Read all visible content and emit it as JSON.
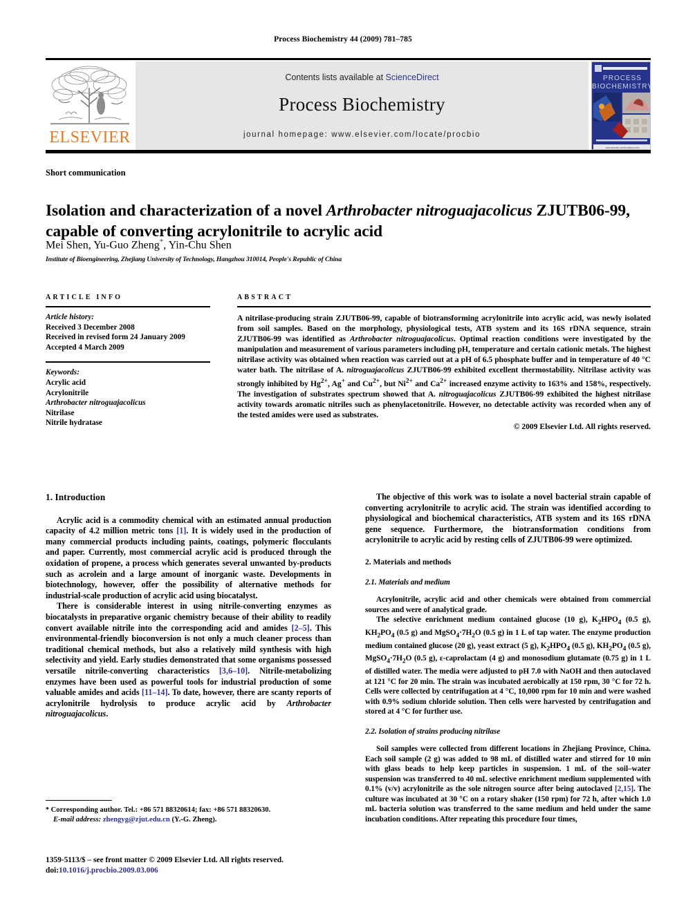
{
  "running_head": "Process Biochemistry 44 (2009) 781–785",
  "masthead": {
    "contents_prefix": "Contents lists available at",
    "sciencedirect": "ScienceDirect",
    "journal_name": "Process Biochemistry",
    "homepage": "journal homepage: www.elsevier.com/locate/procbio",
    "publisher": "ELSEVIER",
    "cover_title_line1": "PROCESS",
    "cover_title_line2": "BIOCHEMISTRY",
    "accent_orange": "#E87722",
    "link_blue": "#2E3192",
    "band_grey": "#e6e6e6"
  },
  "article": {
    "type": "Short communication",
    "title_part1": "Isolation and characterization of a novel ",
    "title_italic": "Arthrobacter nitroguajacolicus",
    "title_part2": " ZJUTB06-99, capable of converting acrylonitrile to acrylic acid",
    "authors": "Mei Shen, Yu-Guo Zheng",
    "author_marker": "*",
    "authors_tail": ", Yin-Chu Shen",
    "affiliation": "Institute of Bioengineering, Zhejiang University of Technology, Hangzhou 310014, People's Republic of China"
  },
  "article_info": {
    "heading": "ARTICLE INFO",
    "history_label": "Article history:",
    "history": [
      "Received 3 December 2008",
      "Received in revised form 24 January 2009",
      "Accepted 4 March 2009"
    ],
    "keywords_label": "Keywords:",
    "keywords": [
      "Acrylic acid",
      "Acrylonitrile",
      "Arthrobacter nitroguajacolicus",
      "Nitrilase",
      "Nitrile hydratase"
    ],
    "keywords_italic_index": 2
  },
  "abstract": {
    "heading": "ABSTRACT",
    "p1": "A nitrilase-producing strain ZJUTB06-99, capable of biotransforming acrylonitrile into acrylic acid, was newly isolated from soil samples. Based on the morphology, physiological tests, ATB system and its 16S rDNA sequence, strain ZJUTB06-99 was identified as ",
    "sp1": "Arthrobacter nitroguajacolicus",
    "p2": ". Optimal reaction conditions were investigated by the manipulation and measurement of various parameters including pH, temperature and certain cationic metals. The highest nitrilase activity was obtained when reaction was carried out at a pH of 6.5 phosphate buffer and in temperature of 40 °C water bath. The nitrilase of A. ",
    "sp2": "nitroguajacolicus",
    "p3": " ZJUTB06-99 exhibited excellent thermostability. Nitrilase activity was strongly inhibited by Hg",
    "ion1": "2+",
    "p4": ", Ag",
    "ion2": "+",
    "p5": " and Cu",
    "ion3": "2+",
    "p6": ", but Ni",
    "ion4": "2+",
    "p7": " and Ca",
    "ion5": "2+",
    "p8": " increased enzyme activity to 163% and 158%, respectively. The investigation of substrates spectrum showed that A. ",
    "sp3": "nitroguajacolicus",
    "p9": " ZJUTB06-99 exhibited the highest nitrilase activity towards aromatic nitriles such as phenylacetonitrile. However, no detectable activity was recorded when any of the tested amides were used as substrates.",
    "copyright": "© 2009 Elsevier Ltd. All rights reserved."
  },
  "sections": {
    "introduction_heading": "1. Introduction",
    "intro_p1_a": "Acrylic acid is a commodity chemical with an estimated annual production capacity of 4.2 million metric tons ",
    "intro_p1_ref1": "[1]",
    "intro_p1_b": ". It is widely used in the production of many commercial products including paints, coatings, polymeric flocculants and paper. Currently, most commercial acrylic acid is produced through the oxidation of propene, a process which generates several unwanted by-products such as acrolein and a large amount of inorganic waste. Developments in biotechnology, however, offer the possibility of alternative methods for industrial-scale production of acrylic acid using biocatalyst.",
    "intro_p2_a": "There is considerable interest in using nitrile-converting enzymes as biocatalysts in preparative organic chemistry because of their ability to readily convert available nitrile into the corresponding acid and amides ",
    "intro_p2_ref1": "[2–5]",
    "intro_p2_b": ". This environmental-friendly bioconversion is not only a much cleaner process than traditional chemical methods, but also a relatively mild synthesis with high selectivity and yield. Early studies demonstrated that some organisms possessed versatile nitrile-converting characteristics ",
    "intro_p2_ref2": "[3,6–10]",
    "intro_p2_c": ". Nitrile-metabolizing enzymes have been used as powerful tools for industrial production of some valuable amides and acids ",
    "intro_p2_ref3": "[11–14]",
    "intro_p2_d": ". To date, however, there are scanty reports of acrylonitrile hydrolysis to produce acrylic acid by ",
    "intro_p2_italic": "Arthrobacter nitroguajacolicus",
    "intro_p2_e": ".",
    "right_p1": "The objective of this work was to isolate a novel bacterial strain capable of converting acrylonitrile to acrylic acid. The strain was identified according to physiological and biochemical characteristics, ATB system and its 16S rDNA gene sequence. Furthermore, the biotransformation conditions from acrylonitrile to acrylic acid by resting cells of ZJUTB06-99 were optimized.",
    "materials_heading": "2. Materials and methods",
    "sub21_heading": "2.1. Materials and medium",
    "sub21_p1": "Acrylonitrile, acrylic acid and other chemicals were obtained from commercial sources and were of analytical grade.",
    "sub21_p2_a": "The selective enrichment medium contained glucose (10 g), K",
    "sub21_sub1": "2",
    "sub21_p2_b": "HPO",
    "sub21_sub2": "4",
    "sub21_p2_c": " (0.5 g), KH",
    "sub21_sub3": "2",
    "sub21_p2_d": "PO",
    "sub21_sub4": "4",
    "sub21_p2_e": " (0.5 g) and MgSO",
    "sub21_sub5": "4",
    "sub21_p2_f": "·7H",
    "sub21_sub6": "2",
    "sub21_p2_g": "O (0.5 g) in 1 L of tap water. The enzyme production medium contained glucose (20 g), yeast extract (5 g), K",
    "sub21_sub7": "2",
    "sub21_p2_h": "HPO",
    "sub21_sub8": "4",
    "sub21_p2_i": " (0.5 g), KH",
    "sub21_sub9": "2",
    "sub21_p2_j": "PO",
    "sub21_sub10": "4",
    "sub21_p2_k": " (0.5 g), MgSO",
    "sub21_sub11": "4",
    "sub21_p2_l": "·7H",
    "sub21_sub12": "2",
    "sub21_p2_m": "O (0.5 g), ε-caprolactam (4 g) and monosodium glutamate (0.75 g) in 1 L of distilled water. The media were adjusted to pH 7.0 with NaOH and then autoclaved at 121 °C for 20 min. The strain was incubated aerobically at 150 rpm, 30 °C for 72 h. Cells were collected by centrifugation at 4 °C, 10,000 rpm for 10 min and were washed with 0.9% sodium chloride solution. Then cells were harvested by centrifugation and stored at 4 °C for further use.",
    "sub22_heading": "2.2. Isolation of strains producing nitrilase",
    "sub22_p1_a": "Soil samples were collected from different locations in Zhejiang Province, China. Each soil sample (2 g) was added to 98 mL of distilled water and stirred for 10 min with glass beads to help keep particles in suspension. 1 mL of the soil–water suspension was transferred to 40 mL selective enrichment medium supplemented with 0.1% (v/v) acrylonitrile as the sole nitrogen source after being autoclaved ",
    "sub22_ref": "[2,15]",
    "sub22_p1_b": ". The culture was incubated at 30 °C on a rotary shaker (150 rpm) for 72 h, after which 1.0 mL bacteria solution was transferred to the same medium and held under the same incubation conditions. After repeating this procedure four times,"
  },
  "footnote": {
    "marker": "*",
    "corresponding": "Corresponding author. Tel.: +86 571 88320614; fax: +86 571 88320630.",
    "email_label": "E-mail address:",
    "email": "zhengyg@zjut.edu.cn",
    "email_tail": "(Y.-G. Zheng)."
  },
  "imprint": {
    "issn_line": "1359-5113/$ – see front matter © 2009 Elsevier Ltd. All rights reserved.",
    "doi_label": "doi:",
    "doi": "10.1016/j.procbio.2009.03.006"
  }
}
